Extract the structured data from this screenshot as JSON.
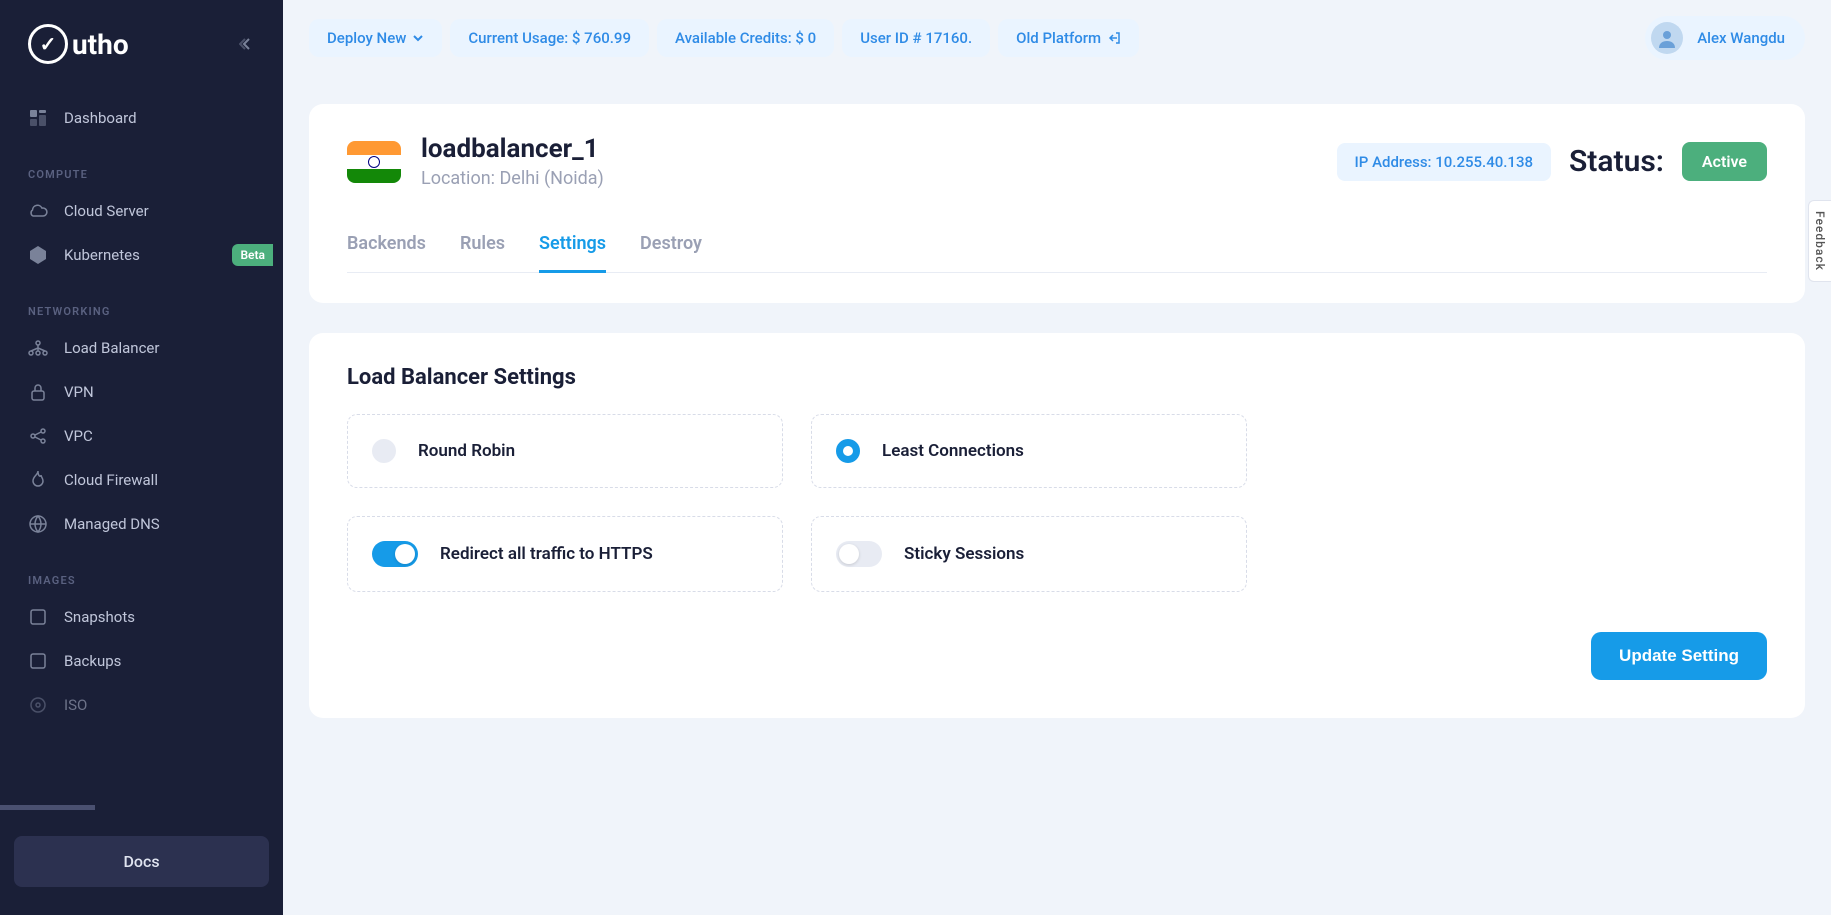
{
  "brand": "utho",
  "topbar": {
    "deploy": "Deploy New",
    "usage": "Current Usage: $ 760.99",
    "credits": "Available Credits: $ 0",
    "user_id": "User ID # 17160.",
    "old_platform": "Old Platform",
    "user_name": "Alex Wangdu"
  },
  "sidebar": {
    "dashboard": "Dashboard",
    "sections": {
      "compute": "COMPUTE",
      "networking": "NETWORKING",
      "images": "IMAGES"
    },
    "items": {
      "cloud_server": "Cloud Server",
      "kubernetes": "Kubernetes",
      "load_balancer": "Load Balancer",
      "vpn": "VPN",
      "vpc": "VPC",
      "cloud_firewall": "Cloud Firewall",
      "managed_dns": "Managed DNS",
      "snapshots": "Snapshots",
      "backups": "Backups",
      "iso": "ISO"
    },
    "beta_badge": "Beta",
    "docs": "Docs"
  },
  "resource": {
    "name": "loadbalancer_1",
    "location": "Location: Delhi (Noida)",
    "ip": "IP Address: 10.255.40.138",
    "status_label": "Status:",
    "status_value": "Active"
  },
  "tabs": {
    "backends": "Backends",
    "rules": "Rules",
    "settings": "Settings",
    "destroy": "Destroy"
  },
  "settings": {
    "title": "Load Balancer Settings",
    "round_robin": "Round Robin",
    "least_conn": "Least Connections",
    "redirect_https": "Redirect all traffic to HTTPS",
    "sticky": "Sticky Sessions",
    "update_btn": "Update Setting"
  },
  "feedback": "Feedback"
}
